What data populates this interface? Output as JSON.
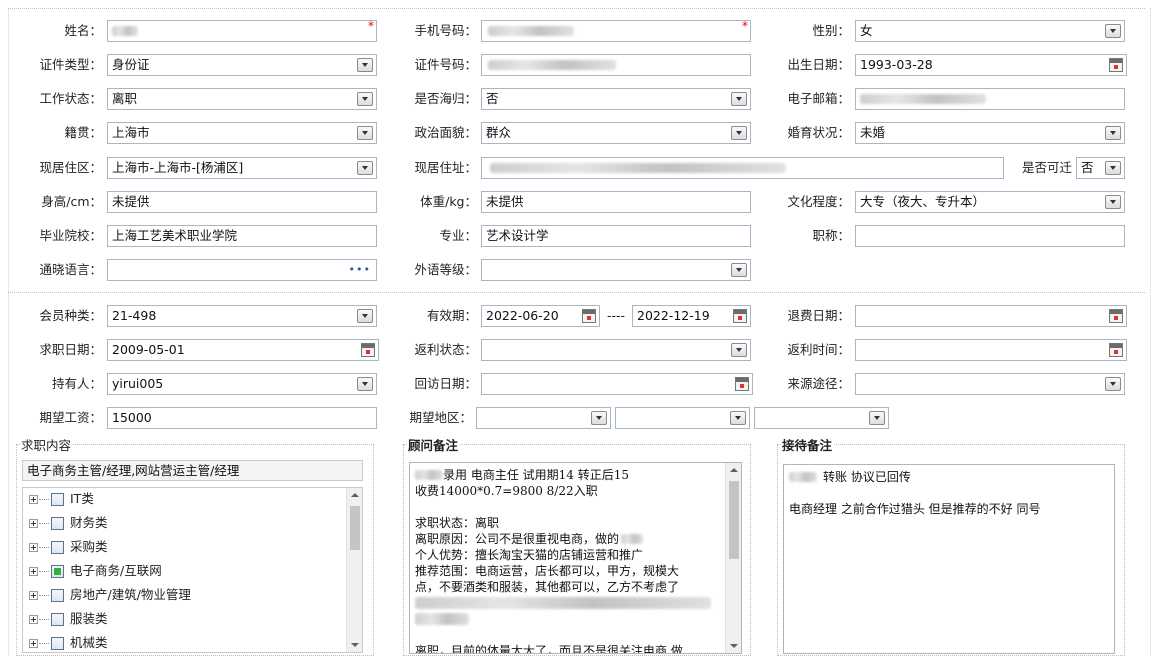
{
  "basic": {
    "name": {
      "label": "姓名："
    },
    "phone": {
      "label": "手机号码："
    },
    "gender": {
      "label": "性别：",
      "value": "女"
    },
    "id_type": {
      "label": "证件类型：",
      "value": "身份证"
    },
    "id_number": {
      "label": "证件号码："
    },
    "birth_date": {
      "label": "出生日期：",
      "value": "1993-03-28"
    },
    "work_status": {
      "label": "工作状态：",
      "value": "离职"
    },
    "returnee": {
      "label": "是否海归：",
      "value": "否"
    },
    "email": {
      "label": "电子邮箱："
    },
    "native_place": {
      "label": "籍贯：",
      "value": "上海市"
    },
    "political_status": {
      "label": "政治面貌：",
      "value": "群众"
    },
    "marital_status": {
      "label": "婚育状况：",
      "value": "未婚"
    },
    "current_area": {
      "label": "现居住区：",
      "value": "上海市-上海市-[杨浦区]"
    },
    "current_address": {
      "label": "现居住址："
    },
    "relocate": {
      "label": "是否可迁",
      "value": "否"
    },
    "height": {
      "label": "身高/cm：",
      "value": "未提供"
    },
    "weight": {
      "label": "体重/kg：",
      "value": "未提供"
    },
    "education": {
      "label": "文化程度：",
      "value": "大专（夜大、专升本）"
    },
    "school": {
      "label": "毕业院校：",
      "value": "上海工艺美术职业学院"
    },
    "major": {
      "label": "专业：",
      "value": "艺术设计学"
    },
    "title": {
      "label": "职称：",
      "value": ""
    },
    "language": {
      "label": "通晓语言：",
      "value": "",
      "more": "•••"
    },
    "foreign_level": {
      "label": "外语等级：",
      "value": ""
    }
  },
  "membership": {
    "member_type": {
      "label": "会员种类：",
      "value": "21-498"
    },
    "valid_period": {
      "label": "有效期：",
      "start": "2022-06-20",
      "sep": "----",
      "end": "2022-12-19"
    },
    "refund_date": {
      "label": "退费日期：",
      "value": ""
    },
    "job_seek_date": {
      "label": "求职日期：",
      "value": "2009-05-01"
    },
    "rebate_status": {
      "label": "返利状态：",
      "value": ""
    },
    "rebate_time": {
      "label": "返利时间：",
      "value": ""
    },
    "holder": {
      "label": "持有人：",
      "value": "yirui005"
    },
    "visit_date": {
      "label": "回访日期：",
      "value": ""
    },
    "source": {
      "label": "来源途径：",
      "value": ""
    },
    "expected_salary": {
      "label": "期望工资：",
      "value": "15000"
    },
    "expected_region": {
      "label": "期望地区："
    }
  },
  "job_content": {
    "legend": "求职内容",
    "summary": "电子商务主管/经理,网站营运主管/经理",
    "tree": [
      {
        "label": "IT类",
        "checked": false
      },
      {
        "label": "财务类",
        "checked": false
      },
      {
        "label": "采购类",
        "checked": false
      },
      {
        "label": "电子商务/互联网",
        "checked": true
      },
      {
        "label": "房地产/建筑/物业管理",
        "checked": false
      },
      {
        "label": "服装类",
        "checked": false
      },
      {
        "label": "机械类",
        "checked": false
      }
    ]
  },
  "consultant_notes": {
    "legend": "顾问备注",
    "lines": [
      "录用 电商主任 试用期14  转正后15",
      "收费14000*0.7=9800  8/22入职",
      "",
      "求职状态：离职",
      "离职原因：公司不是很重视电商，做的",
      "个人优势：擅长淘宝天猫的店铺运营和推广",
      "推荐范围：电商运营，店长都可以，甲方，规模大",
      "点，不要酒类和服装，其他都可以，乙方不考虑了",
      "",
      "",
      "",
      "离职，目前的体量太大了，而且不是很关注电商 做"
    ]
  },
  "reception_notes": {
    "legend": "接待备注",
    "lines": [
      "转账 协议已回传",
      "",
      "电商经理  之前合作过猎头 但是推荐的不好  同号"
    ]
  }
}
